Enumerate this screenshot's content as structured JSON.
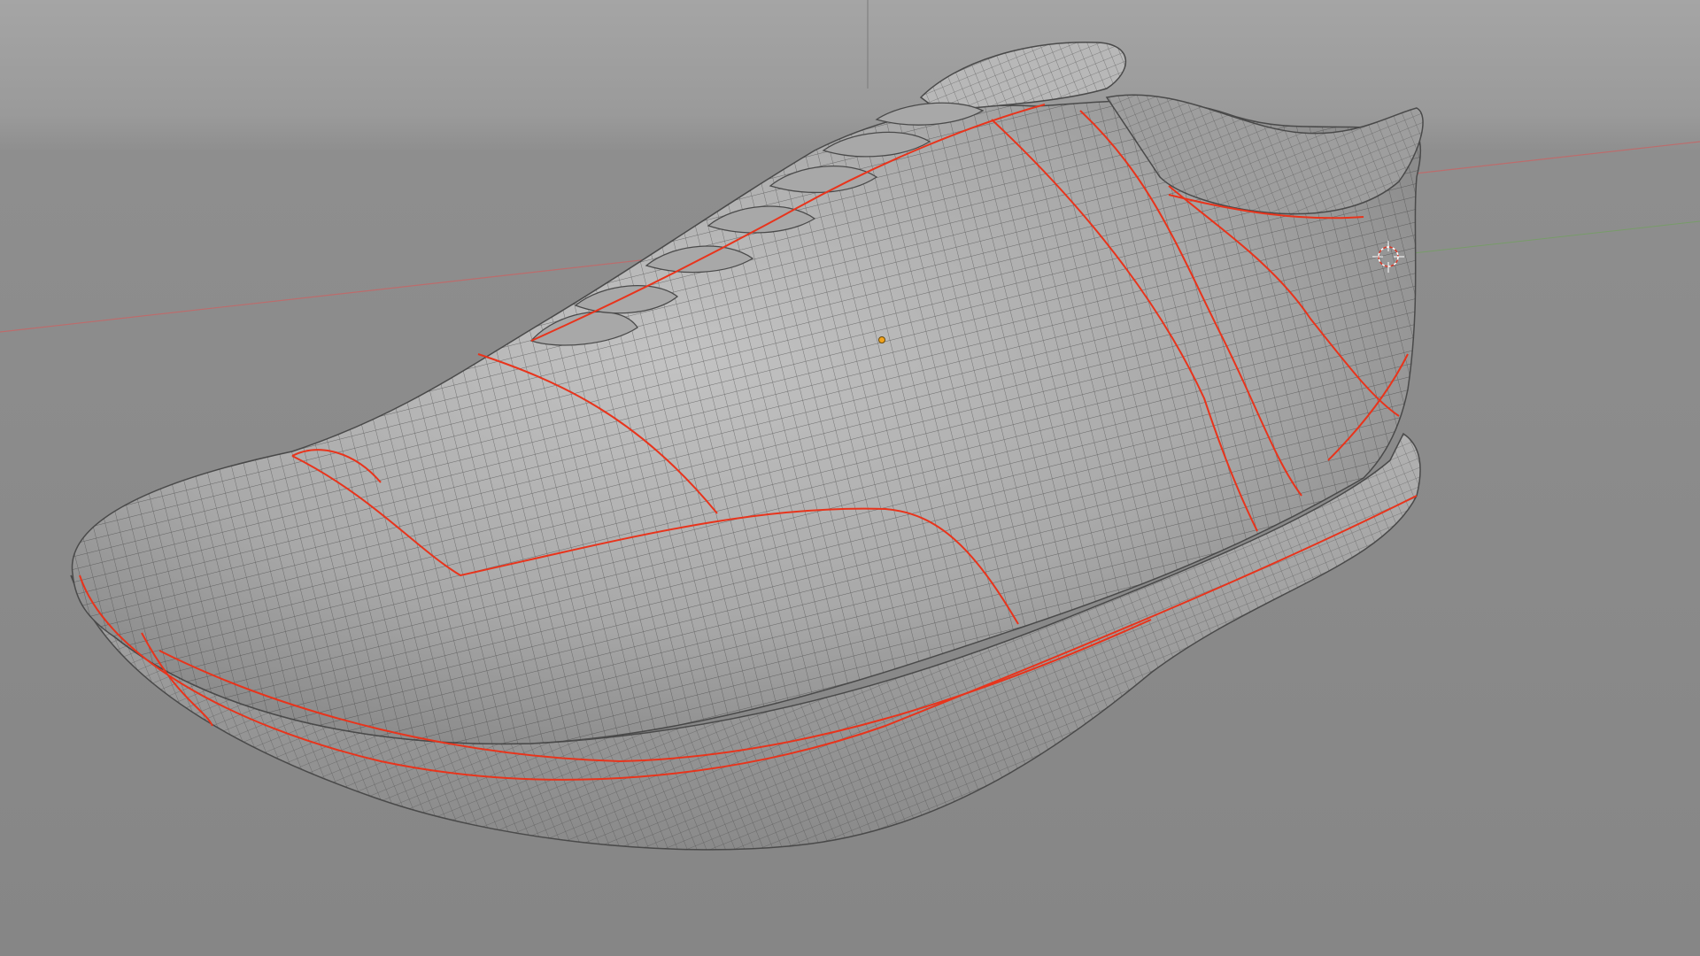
{
  "viewport": {
    "background_top": "#a9a9a9",
    "background_bottom": "#878787",
    "horizon_shade": "#9a9a9a"
  },
  "model": {
    "name": "sneaker-mesh",
    "surface_color": "#b4b4b4",
    "surface_shadow": "#7d7d7d",
    "wire_color": "#3a3a3a",
    "seam_color": "#e8341c",
    "origin_color": "#f2a31c"
  },
  "axes": {
    "x_axis_color": "#c86464",
    "y_axis_color": "#6fa25a"
  },
  "icons": {
    "origin": "object-origin-dot",
    "cursor": "3d-cursor-icon"
  }
}
